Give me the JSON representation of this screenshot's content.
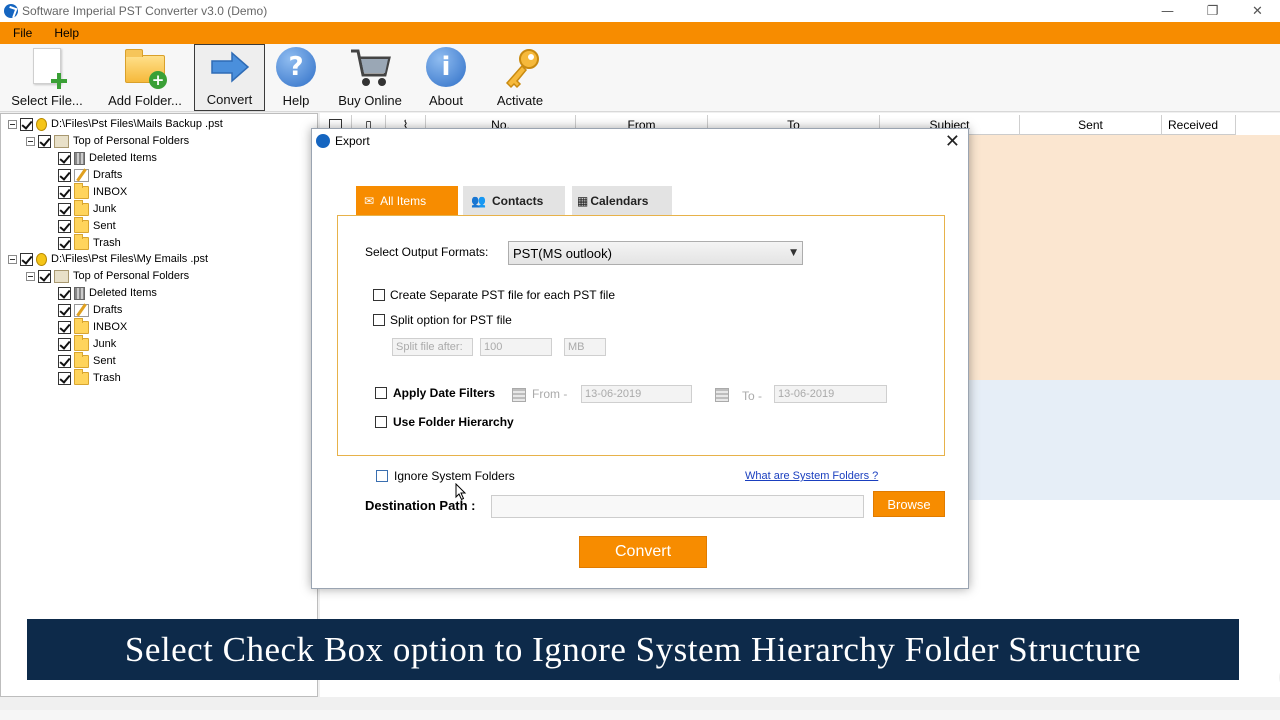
{
  "window": {
    "title": "Software Imperial PST Converter v3.0 (Demo)",
    "controls": {
      "minimize": "—",
      "restore": "❐",
      "close": "✕"
    }
  },
  "menu": {
    "items": [
      "File",
      "Help"
    ]
  },
  "toolbar": {
    "select_file": "Select File...",
    "add_folder": "Add Folder...",
    "convert": "Convert",
    "help": "Help",
    "buy_online": "Buy Online",
    "about": "About",
    "activate": "Activate"
  },
  "tree": {
    "pst1": "D:\\Files\\Pst Files\\Mails Backup .pst",
    "pst2": "D:\\Files\\Pst Files\\My Emails .pst",
    "top_folder": "Top of Personal Folders",
    "folders": [
      "Deleted Items",
      "Drafts",
      "INBOX",
      "Junk",
      "Sent",
      "Trash"
    ]
  },
  "list": {
    "columns": [
      "No.",
      "From",
      "To",
      "Subject",
      "Sent",
      "Received"
    ]
  },
  "dialog": {
    "title": "Export",
    "close": "✕",
    "tabs": {
      "all_items": "All Items",
      "contacts": "Contacts",
      "calendars": "Calendars"
    },
    "output_format_label": "Select Output Formats:",
    "output_format_value": "PST(MS outlook)",
    "create_separate": "Create Separate PST file for each PST file",
    "split_option": "Split option for PST file",
    "split_after_label": "Split file after:",
    "split_value": "100",
    "split_unit": "MB",
    "apply_date_filters": "Apply Date Filters",
    "from_label": "From -",
    "from_date": "13-06-2019",
    "to_label": "To -",
    "to_date": "13-06-2019",
    "use_folder_hierarchy": "Use Folder Hierarchy",
    "ignore_system_folders": "Ignore System Folders",
    "what_are_system_folders": "What are System Folders ?",
    "destination_label": "Destination Path :",
    "browse": "Browse",
    "convert": "Convert"
  },
  "caption": "Select Check Box option to Ignore System Hierarchy Folder Structure",
  "colors": {
    "accent": "#f78c00",
    "caption_bg": "#0d2a4a",
    "link": "#1a3fbf"
  }
}
